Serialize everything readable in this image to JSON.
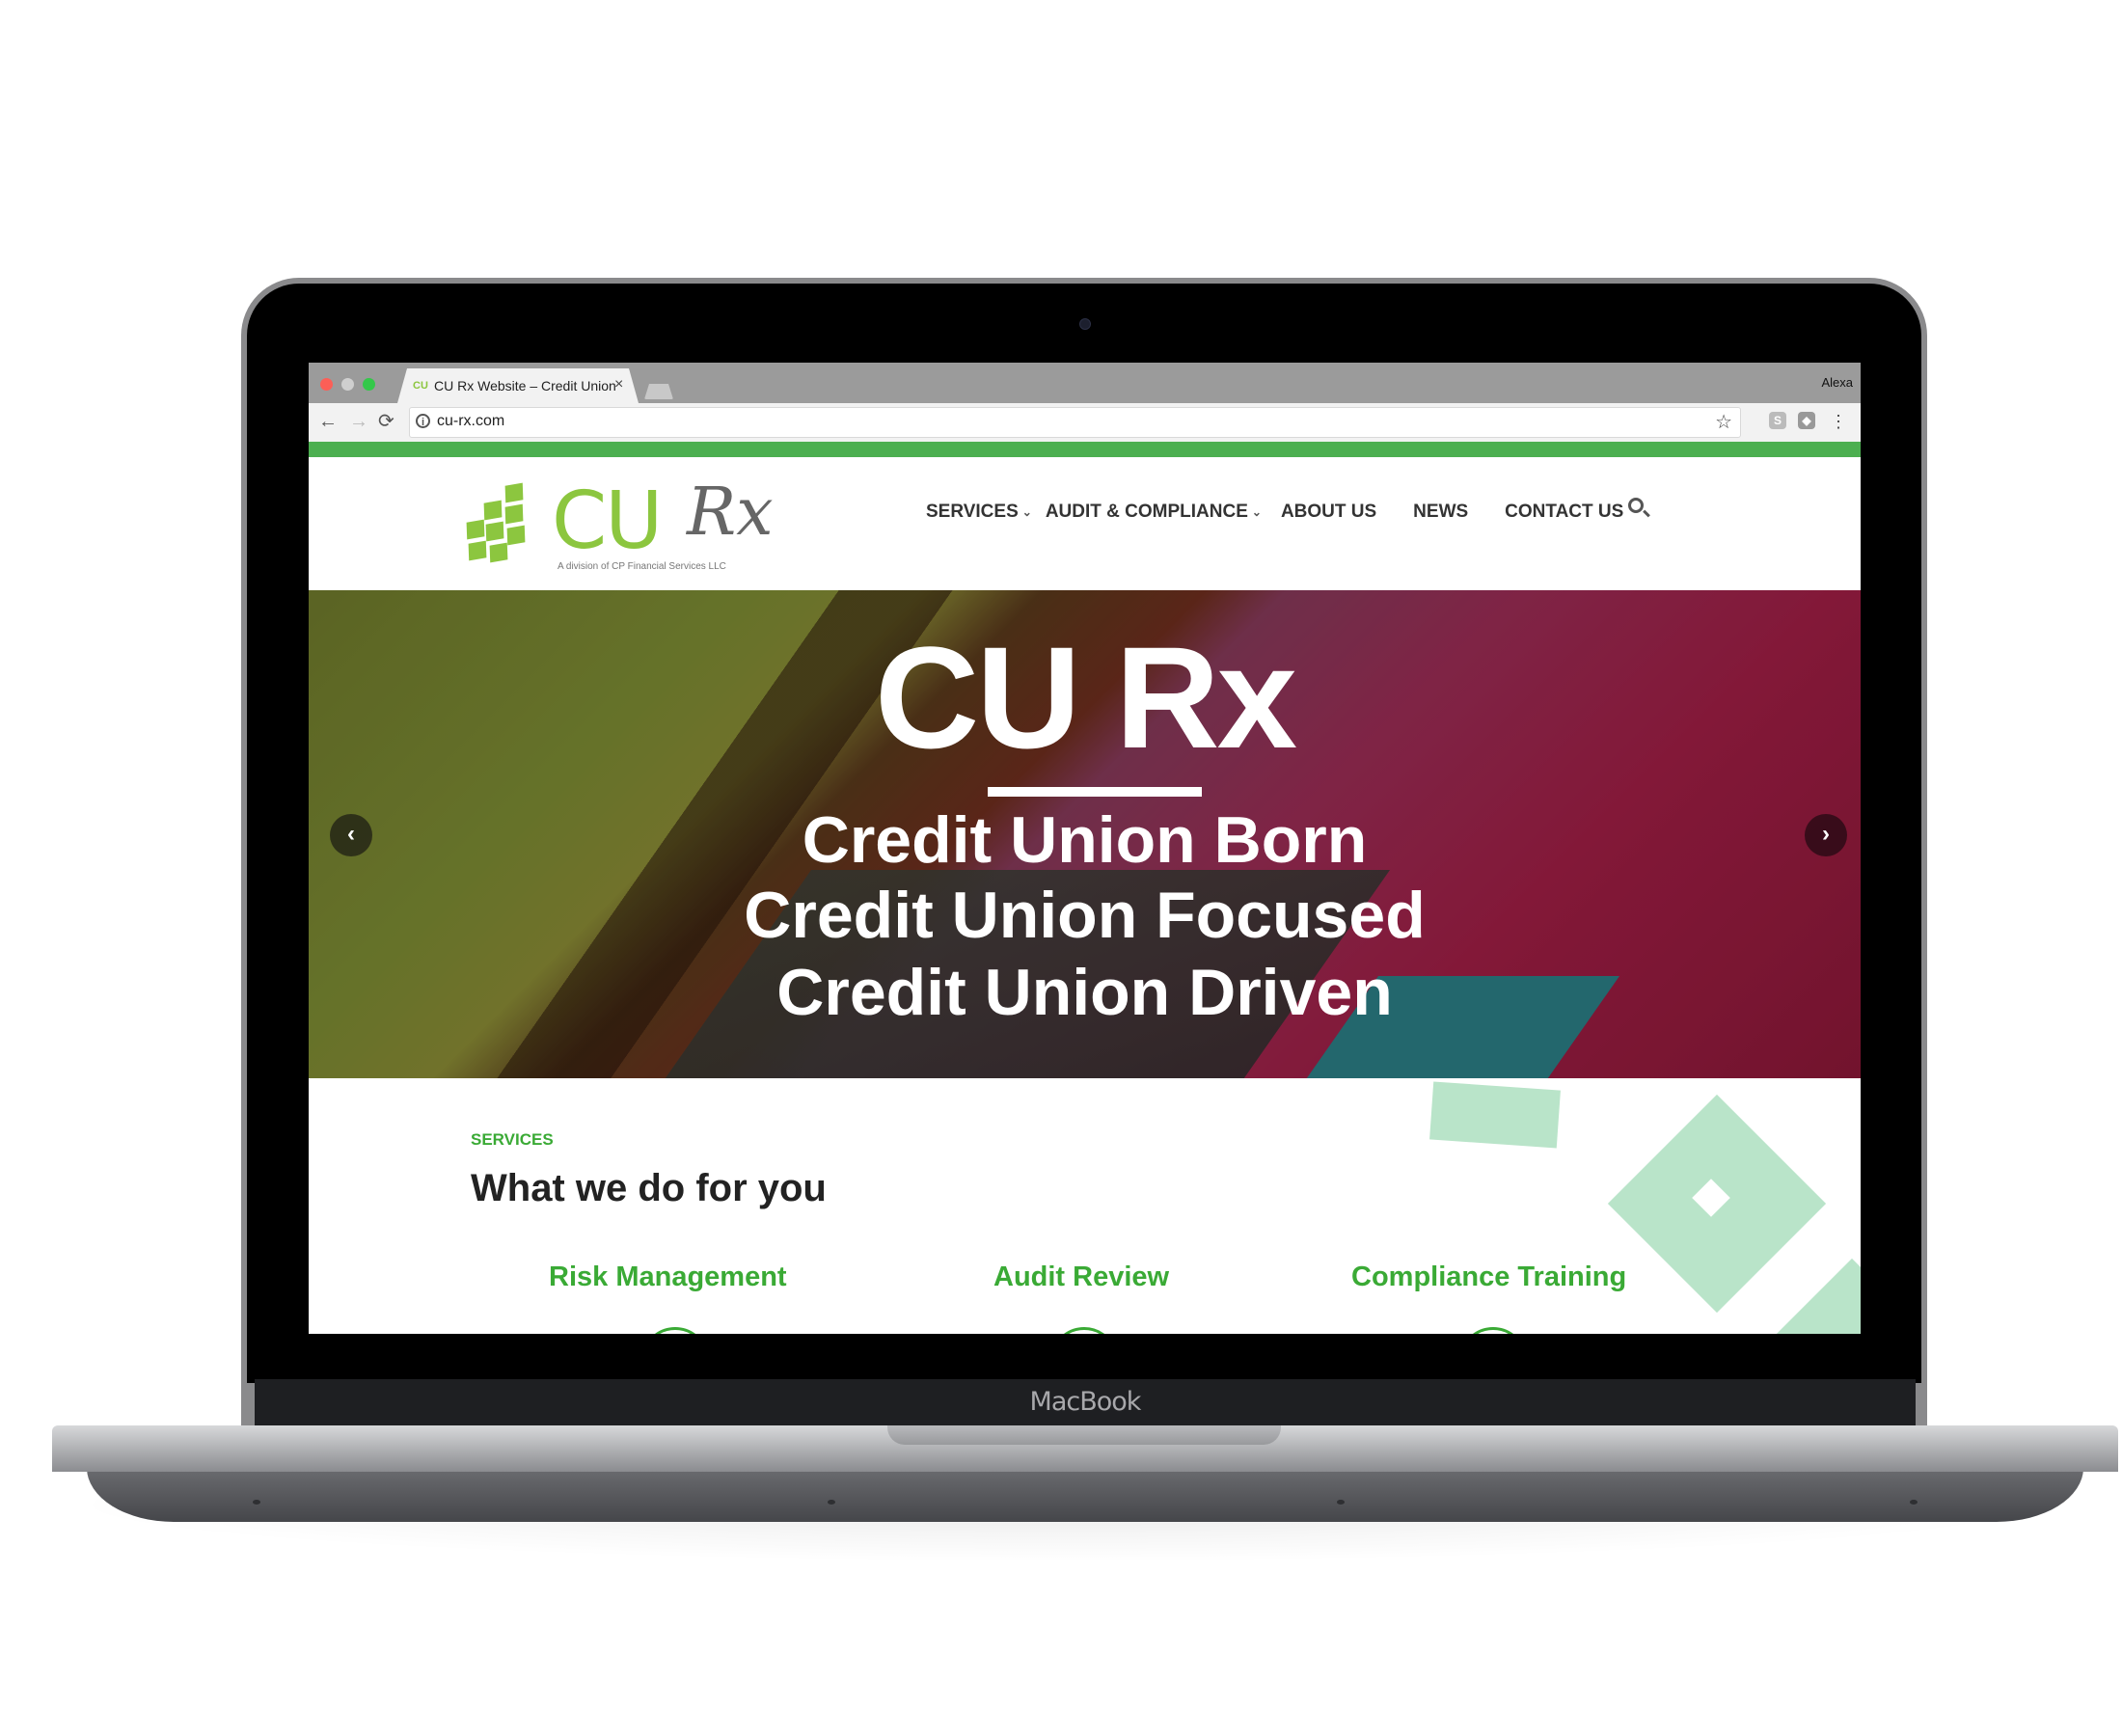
{
  "device": {
    "label": "MacBook"
  },
  "browser": {
    "tab_title": "CU Rx Website – Credit Union",
    "favicon_label": "CU",
    "close_glyph": "×",
    "user": "Alexa",
    "url": "cu-rx.com",
    "back_glyph": "←",
    "forward_glyph": "→",
    "reload_glyph": "⟳",
    "star_glyph": "☆",
    "info_glyph": "i",
    "ext1_glyph": "S",
    "ext2_glyph": "◆",
    "menu_glyph": "⋮"
  },
  "site": {
    "brand_color": "#4caf50",
    "logo": {
      "primary": "CU",
      "secondary": "Rx",
      "tagline": "A division of CP Financial Services LLC"
    },
    "nav": [
      {
        "label": "SERVICES",
        "has_dropdown": true
      },
      {
        "label": "AUDIT & COMPLIANCE",
        "has_dropdown": true
      },
      {
        "label": "ABOUT US",
        "has_dropdown": false
      },
      {
        "label": "NEWS",
        "has_dropdown": false
      },
      {
        "label": "CONTACT US",
        "has_dropdown": false
      }
    ],
    "chevron_glyph": "⌄",
    "hero": {
      "title": "CU Rx",
      "lines": [
        "Credit Union Born",
        "Credit Union Focused",
        "Credit Union Driven"
      ],
      "prev_glyph": "‹",
      "next_glyph": "›"
    },
    "services": {
      "kicker": "SERVICES",
      "title": "What we do for you",
      "items": [
        "Risk Management",
        "Audit Review",
        "Compliance Training"
      ]
    }
  }
}
